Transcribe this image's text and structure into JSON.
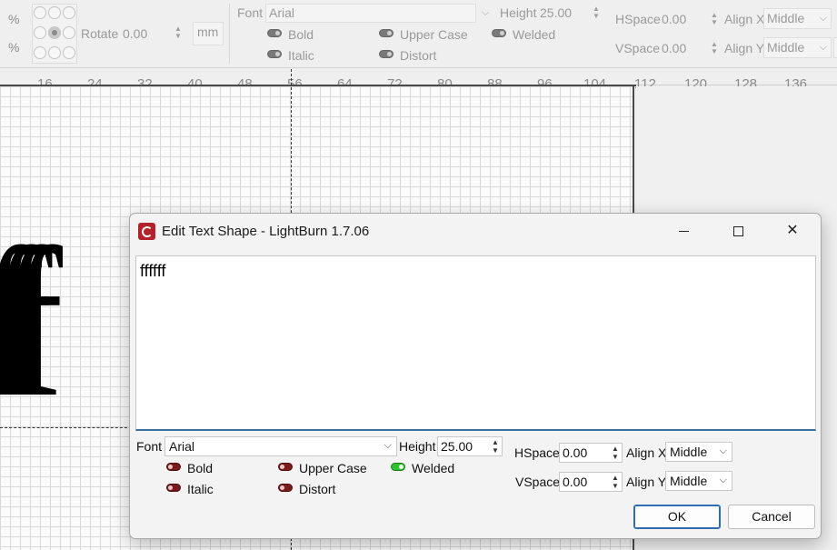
{
  "toolbar": {
    "pct_symbol": "%",
    "rotate_label": "Rotate",
    "rotate_value": "0.00",
    "unit_label": "mm",
    "font_label": "Font",
    "font_value": "Arial",
    "height_label": "Height",
    "height_value": "25.00",
    "bold_label": "Bold",
    "italic_label": "Italic",
    "upper_case_label": "Upper Case",
    "distort_label": "Distort",
    "welded_label": "Welded",
    "hspace_label": "HSpace",
    "hspace_value": "0.00",
    "vspace_label": "VSpace",
    "vspace_value": "0.00",
    "align_x_label": "Align X",
    "align_x_value": "Middle",
    "align_y_label": "Align Y",
    "align_y_value": "Middle"
  },
  "ruler": {
    "ticks": [
      "16",
      "24",
      "32",
      "40",
      "48",
      "56",
      "64",
      "72",
      "80",
      "88",
      "96",
      "104",
      "112",
      "120",
      "128",
      "136"
    ]
  },
  "canvas": {
    "text_preview": "ffff"
  },
  "dialog": {
    "title": "Edit Text Shape - LightBurn 1.7.06",
    "text_content": "ffffff",
    "font_label": "Font",
    "font_value": "Arial",
    "height_label": "Height",
    "height_value": "25.00",
    "bold_label": "Bold",
    "italic_label": "Italic",
    "upper_case_label": "Upper Case",
    "distort_label": "Distort",
    "welded_label": "Welded",
    "hspace_label": "HSpace",
    "hspace_value": "0.00",
    "vspace_label": "VSpace",
    "vspace_value": "0.00",
    "align_x_label": "Align X",
    "align_x_value": "Middle",
    "align_y_label": "Align Y",
    "align_y_value": "Middle",
    "ok_label": "OK",
    "cancel_label": "Cancel",
    "close_glyph": "✕",
    "welded_on": true,
    "accent_color": "#2f6db3",
    "toggle_off_color": "#7a1a1a",
    "toggle_on_color": "#2fc12f"
  }
}
